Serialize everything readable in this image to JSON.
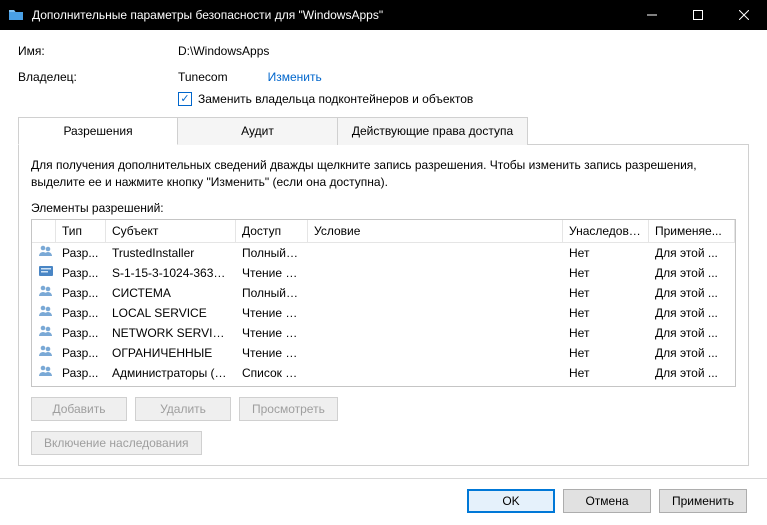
{
  "window": {
    "title": "Дополнительные параметры безопасности  для \"WindowsApps\""
  },
  "name": {
    "label": "Имя:",
    "value": "D:\\WindowsApps"
  },
  "owner": {
    "label": "Владелец:",
    "value": "Tunecom",
    "change_link": "Изменить"
  },
  "replace_owner": {
    "label": "Заменить владельца подконтейнеров и объектов",
    "checked": true
  },
  "tabs": {
    "permissions": "Разрешения",
    "audit": "Аудит",
    "effective": "Действующие права доступа"
  },
  "description": "Для получения дополнительных сведений дважды щелкните запись разрешения. Чтобы изменить запись разрешения, выделите ее и нажмите кнопку \"Изменить\" (если она доступна).",
  "list_label": "Элементы разрешений:",
  "columns": {
    "type": "Тип",
    "subject": "Субъект",
    "access": "Доступ",
    "condition": "Условие",
    "inherited": "Унаследова...",
    "applies": "Применяе..."
  },
  "rows": [
    {
      "icon": "group",
      "type": "Разр...",
      "subject": "TrustedInstaller",
      "access": "Полный д...",
      "condition": "",
      "inherited": "Нет",
      "applies": "Для этой ..."
    },
    {
      "icon": "sid",
      "type": "Разр...",
      "subject": "S-1-15-3-1024-363528...",
      "access": "Чтение и ...",
      "condition": "",
      "inherited": "Нет",
      "applies": "Для этой ..."
    },
    {
      "icon": "group",
      "type": "Разр...",
      "subject": "СИСТЕМА",
      "access": "Полный д...",
      "condition": "",
      "inherited": "Нет",
      "applies": "Для этой ..."
    },
    {
      "icon": "group",
      "type": "Разр...",
      "subject": "LOCAL SERVICE",
      "access": "Чтение и ...",
      "condition": "",
      "inherited": "Нет",
      "applies": "Для этой ..."
    },
    {
      "icon": "group",
      "type": "Разр...",
      "subject": "NETWORK SERVICE",
      "access": "Чтение и ...",
      "condition": "",
      "inherited": "Нет",
      "applies": "Для этой ..."
    },
    {
      "icon": "group",
      "type": "Разр...",
      "subject": "ОГРАНИЧЕННЫЕ",
      "access": "Чтение и ...",
      "condition": "",
      "inherited": "Нет",
      "applies": "Для этой ..."
    },
    {
      "icon": "group",
      "type": "Разр...",
      "subject": "Администраторы (DE...",
      "access": "Список с...",
      "condition": "",
      "inherited": "Нет",
      "applies": "Для этой ..."
    }
  ],
  "buttons": {
    "add": "Добавить",
    "remove": "Удалить",
    "view": "Просмотреть",
    "enable_inherit": "Включение наследования",
    "ok": "OK",
    "cancel": "Отмена",
    "apply": "Применить"
  }
}
